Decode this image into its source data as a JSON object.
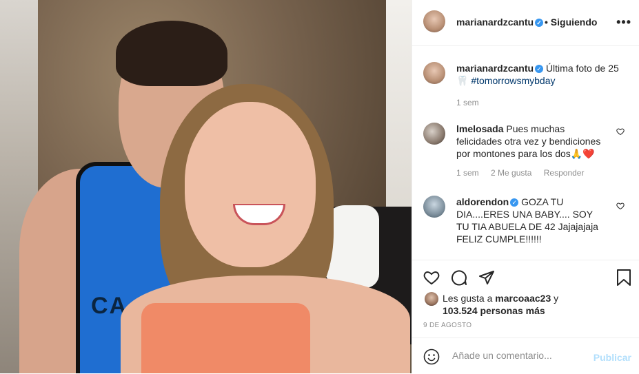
{
  "post": {
    "author": "marianardzcantu",
    "follow_state": "• Siguiendo",
    "caption_text": "Última foto de 25",
    "caption_hashtag": "#tomorrowsmybday",
    "caption_emoji": "🦷",
    "caption_time": "1 sem"
  },
  "comments": [
    {
      "user": "lmelosada",
      "text": "Pues muchas felicidades otra vez y bendiciones por montones para los dos🙏❤️",
      "time": "1 sem",
      "likes": "2 Me gusta",
      "reply": "Responder"
    },
    {
      "user": "aldorendon",
      "text": "GOZA TU DIA....ERES UNA BABY.... SOY TU TIA ABUELA DE 42 Jajajajaja FELIZ CUMPLE!!!!!!"
    }
  ],
  "likes": {
    "prefix": "Les gusta a",
    "user": "marcoaac23",
    "conj": "y",
    "count": "103.524 personas más"
  },
  "date": "9 DE AGOSTO",
  "add_comment": {
    "placeholder": "Añade un comentario...",
    "publish_label": "Publicar"
  },
  "colors": {
    "verified": "#3897f0",
    "link": "#00376b",
    "publish_disabled": "#b2dffc"
  }
}
